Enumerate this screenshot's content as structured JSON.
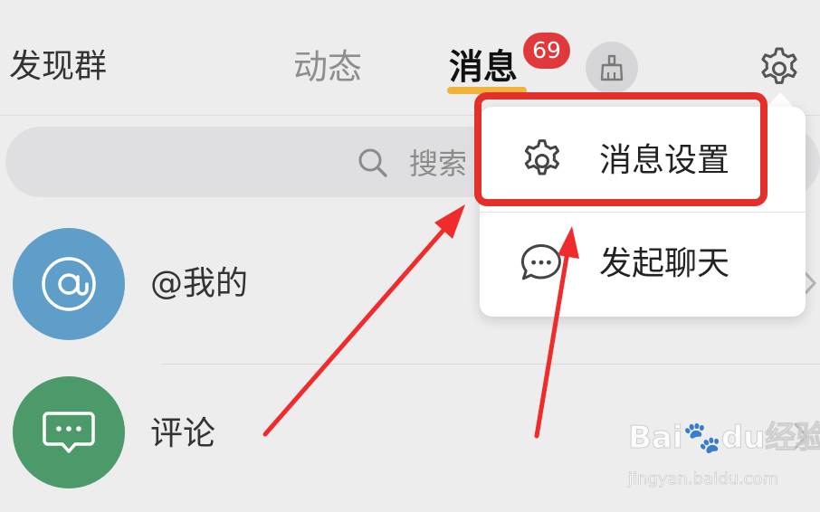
{
  "header": {
    "left_title": "发现群",
    "tabs": [
      {
        "label": "动态",
        "active": false
      },
      {
        "label": "消息",
        "active": true
      }
    ],
    "message_badge": "69",
    "clean_icon": "broom-icon",
    "settings_icon": "gear-icon"
  },
  "search": {
    "placeholder": "搜索",
    "icon": "search-icon"
  },
  "list": [
    {
      "label": "@我的",
      "icon": "at-icon",
      "color": "#5f9ec8"
    },
    {
      "label": "评论",
      "icon": "comment-icon",
      "color": "#4c9a69"
    }
  ],
  "dropdown": {
    "items": [
      {
        "label": "消息设置",
        "icon": "gear-icon"
      },
      {
        "label": "发起聊天",
        "icon": "chat-bubble-icon"
      }
    ]
  },
  "watermark": {
    "brand": "Bai🐾du经验",
    "url": "jingyan.baidu.com"
  },
  "colors": {
    "accent": "#f2b33a",
    "badge": "#e0393b",
    "highlight": "#e3302b"
  }
}
